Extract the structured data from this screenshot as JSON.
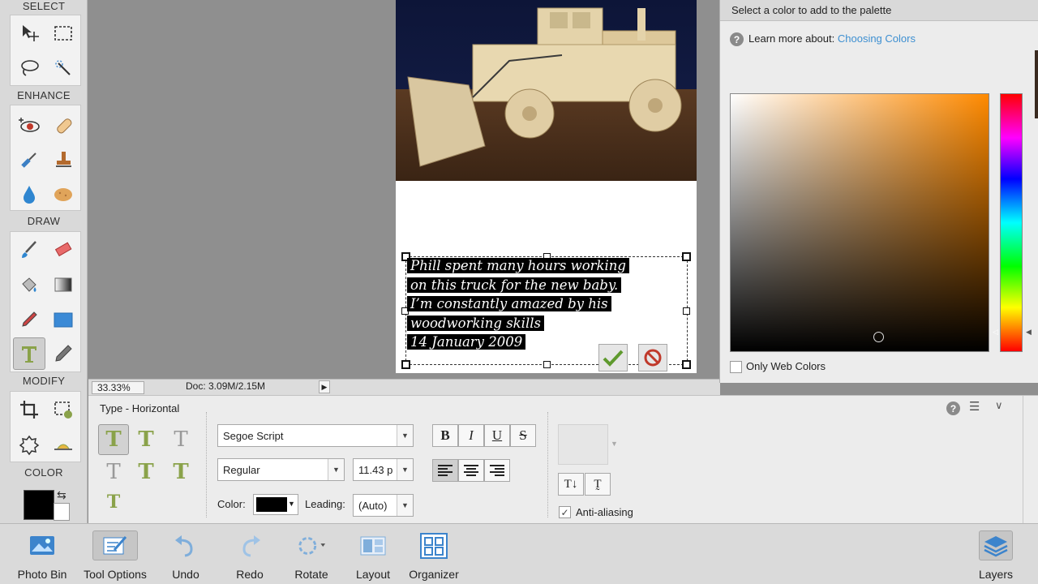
{
  "toolbox": {
    "sections": [
      "SELECT",
      "ENHANCE",
      "DRAW",
      "MODIFY",
      "COLOR"
    ]
  },
  "canvas": {
    "text_lines": [
      "Phill spent many hours working",
      "on this truck for the new baby.",
      "I’m constantly amazed by his",
      "woodworking skills",
      "14 January 2009"
    ]
  },
  "status": {
    "zoom": "33.33%",
    "doc": "Doc: 3.09M/2.15M"
  },
  "picker": {
    "title": "Select a color to add to the palette",
    "learn_prefix": "Learn more about:",
    "learn_link": "Choosing Colors",
    "only_web_colors": "Only Web Colors",
    "link_color": "#3d8fd1",
    "selected_hue": "#ff8a00"
  },
  "options": {
    "title": "Type - Horizontal",
    "font_family": "Segoe Script",
    "font_style": "Regular",
    "font_size": "11.43 p",
    "color_label": "Color:",
    "leading_label": "Leading:",
    "leading_value": "(Auto)",
    "bold": "B",
    "italic": "I",
    "underline": "U",
    "strike": "S",
    "anti_aliasing": "Anti-aliasing",
    "text_color": "#000000"
  },
  "taskbar": {
    "items": [
      {
        "label": "Photo Bin"
      },
      {
        "label": "Tool Options"
      },
      {
        "label": "Undo"
      },
      {
        "label": "Redo"
      },
      {
        "label": "Rotate"
      },
      {
        "label": "Layout"
      },
      {
        "label": "Organizer"
      },
      {
        "label": "Layers"
      }
    ]
  }
}
